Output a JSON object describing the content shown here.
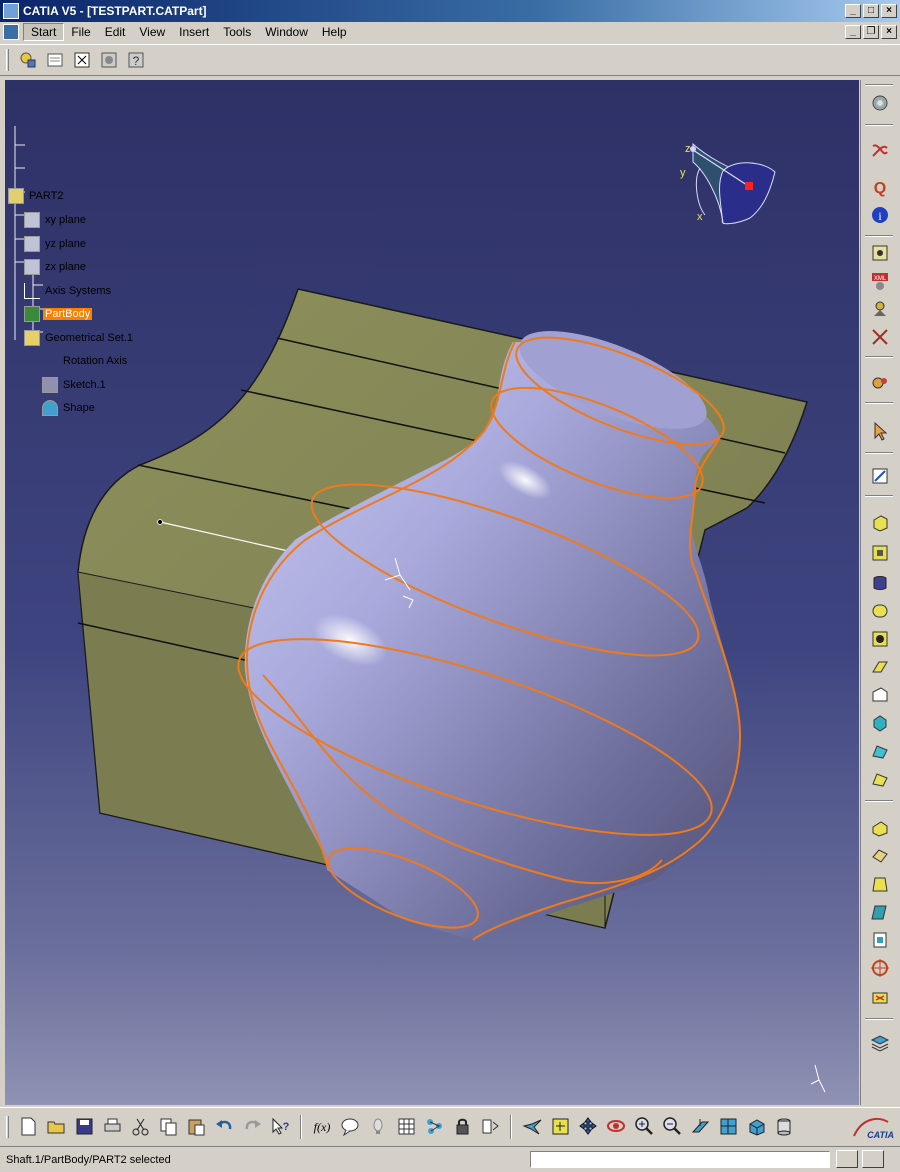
{
  "window": {
    "title": "CATIA V5 - [TESTPART.CATPart]",
    "controls": [
      "minimize",
      "maximize",
      "close"
    ]
  },
  "menu": {
    "items": [
      {
        "label": "Start"
      },
      {
        "label": "File"
      },
      {
        "label": "Edit"
      },
      {
        "label": "View"
      },
      {
        "label": "Insert"
      },
      {
        "label": "Tools"
      },
      {
        "label": "Window"
      },
      {
        "label": "Help"
      }
    ]
  },
  "toolbar_top": {
    "icons": [
      "workbench-icon",
      "properties-icon",
      "fit-tree-icon",
      "snapshot-icon",
      "whats-this-icon"
    ]
  },
  "tree": {
    "nodes": [
      {
        "label": "PART2",
        "icon": "part-icon"
      },
      {
        "label": "xy plane",
        "icon": "plane-icon"
      },
      {
        "label": "yz plane",
        "icon": "plane-icon"
      },
      {
        "label": "zx plane",
        "icon": "plane-icon"
      },
      {
        "label": "Axis Systems",
        "icon": "axis-systems-icon"
      },
      {
        "label": "PartBody",
        "icon": "partbody-icon"
      },
      {
        "label": "Geometrical Set.1",
        "icon": "geometrical-set-icon"
      },
      {
        "label": "Rotation Axis",
        "icon": "line-icon"
      },
      {
        "label": "Sketch.1",
        "icon": "sketch-icon"
      },
      {
        "label": "Shape",
        "icon": "shape-icon"
      }
    ],
    "selected": "PartBody"
  },
  "compass_labels": {
    "x": "x",
    "y": "y",
    "z": "z"
  },
  "toolbar_right": {
    "icons": [
      "options-icon",
      "product-icon",
      "query-icon",
      "info-icon",
      "visualization-icon",
      "xml-icon",
      "measure-icon",
      "tools-icon",
      "analysis-icon",
      "select-icon",
      "sketcher-icon",
      "pad-icon",
      "pocket-icon",
      "shaft-icon",
      "groove-icon",
      "hole-icon",
      "rib-icon",
      "slot-icon",
      "stiffener-icon",
      "multi-section-icon",
      "removed-multi-section-icon",
      "fillet-icon",
      "chamfer-icon",
      "draft-icon",
      "shell-icon",
      "thickness-icon",
      "thread-icon",
      "split-icon",
      "thick-surface-icon",
      "close-surface-icon",
      "layers-icon"
    ]
  },
  "toolbar_bottom": {
    "icons": [
      "new-icon",
      "open-icon",
      "save-icon",
      "print-icon",
      "cut-icon",
      "copy-icon",
      "paste-icon",
      "undo-icon",
      "redo-icon",
      "whats-this-icon",
      "formula-icon",
      "comment-icon",
      "light-icon",
      "table-icon",
      "knowledge-icon",
      "lock-icon",
      "parameters-icon",
      "fly-icon",
      "fit-all-icon",
      "pan-icon",
      "rotate-icon",
      "zoom-in-icon",
      "zoom-out-icon",
      "normal-view-icon",
      "iso-view-icon",
      "render-style-icon",
      "hide-show-icon"
    ],
    "logo_text": "CATIA"
  },
  "status": {
    "message": "Shaft.1/PartBody/PART2 selected",
    "command_value": ""
  }
}
